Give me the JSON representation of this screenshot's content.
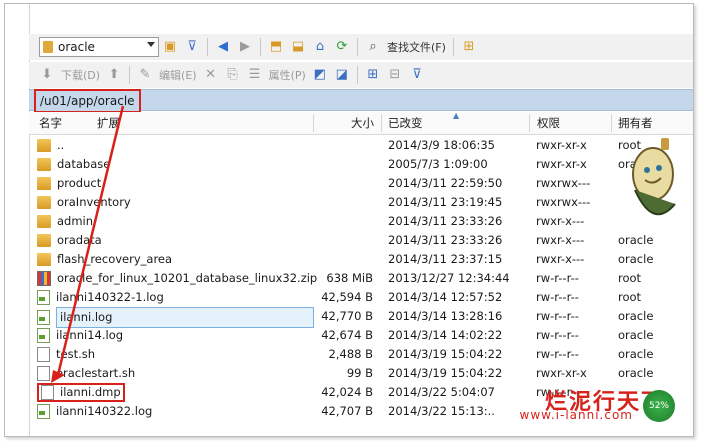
{
  "toolbar_top": {
    "location_value": "oracle",
    "find_files_label": "查找文件(F)"
  },
  "toolbar_second": {
    "download_label": "下载(D)",
    "edit_label": "编辑(E)",
    "properties_label": "属性(P)"
  },
  "path": "/u01/app/oracle",
  "columns": {
    "name": "名字",
    "ext": "扩展",
    "size": "大小",
    "modified": "已改变",
    "perms": "权限",
    "owner": "拥有者"
  },
  "files": [
    {
      "name": "..",
      "icon": "up-folder-icon",
      "size": "",
      "modified": "2014/3/9 18:06:35",
      "perms": "rwxr-xr-x",
      "owner": "root"
    },
    {
      "name": "database",
      "icon": "folder-icon",
      "size": "",
      "modified": "2005/7/3 1:09:00",
      "perms": "rwxr-xr-x",
      "owner": "ora"
    },
    {
      "name": "product",
      "icon": "folder-icon",
      "size": "",
      "modified": "2014/3/11 22:59:50",
      "perms": "rwxrwx---",
      "owner": ""
    },
    {
      "name": "oraInventory",
      "icon": "folder-icon",
      "size": "",
      "modified": "2014/3/11 23:19:45",
      "perms": "rwxrwx---",
      "owner": ""
    },
    {
      "name": "admin",
      "icon": "folder-icon",
      "size": "",
      "modified": "2014/3/11 23:33:26",
      "perms": "rwxr-x---",
      "owner": ""
    },
    {
      "name": "oradata",
      "icon": "folder-icon",
      "size": "",
      "modified": "2014/3/11 23:33:26",
      "perms": "rwxr-x---",
      "owner": "oracle"
    },
    {
      "name": "flash_recovery_area",
      "icon": "folder-icon",
      "size": "",
      "modified": "2014/3/11 23:37:15",
      "perms": "rwxr-x---",
      "owner": "oracle"
    },
    {
      "name": "oracle_for_linux_10201_database_linux32.zip",
      "icon": "zip-icon",
      "size": "638 MiB",
      "modified": "2013/12/27 12:34:44",
      "perms": "rw-r--r--",
      "owner": "root"
    },
    {
      "name": "ilanni140322-1.log",
      "icon": "log-file-icon",
      "size": "42,594 B",
      "modified": "2014/3/14 12:57:52",
      "perms": "rw-r--r--",
      "owner": "root"
    },
    {
      "name": "ilanni.log",
      "icon": "log-file-icon",
      "size": "42,770 B",
      "modified": "2014/3/14 13:28:16",
      "perms": "rw-r--r--",
      "owner": "oracle"
    },
    {
      "name": "ilanni14.log",
      "icon": "log-file-icon",
      "size": "42,674 B",
      "modified": "2014/3/14 14:02:22",
      "perms": "rw-r--r--",
      "owner": "oracle"
    },
    {
      "name": "test.sh",
      "icon": "file-icon",
      "size": "2,488 B",
      "modified": "2014/3/19 15:04:22",
      "perms": "rw-r--r--",
      "owner": "oracle"
    },
    {
      "name": "oraclestart.sh",
      "icon": "file-icon",
      "size": "99 B",
      "modified": "2014/3/19 15:04:22",
      "perms": "rwxr-xr-x",
      "owner": "oracle"
    },
    {
      "name": "ilanni.dmp",
      "icon": "file-icon",
      "size": "42,024 B",
      "modified": "2014/3/22 5:04:07",
      "perms": "rw-r--r--",
      "owner": ""
    },
    {
      "name": "ilanni140322.log",
      "icon": "log-file-icon",
      "size": "42,707 B",
      "modified": "2014/3/22 15:13:..",
      "perms": "",
      "owner": ""
    }
  ],
  "watermark": {
    "text": "烂泥行天下",
    "url": "www.i-lanni.com",
    "badge": "52%"
  },
  "colors": {
    "highlight_red": "#d6221a",
    "path_bar": "#c5d7ea",
    "selection": "#e5f1fb"
  }
}
